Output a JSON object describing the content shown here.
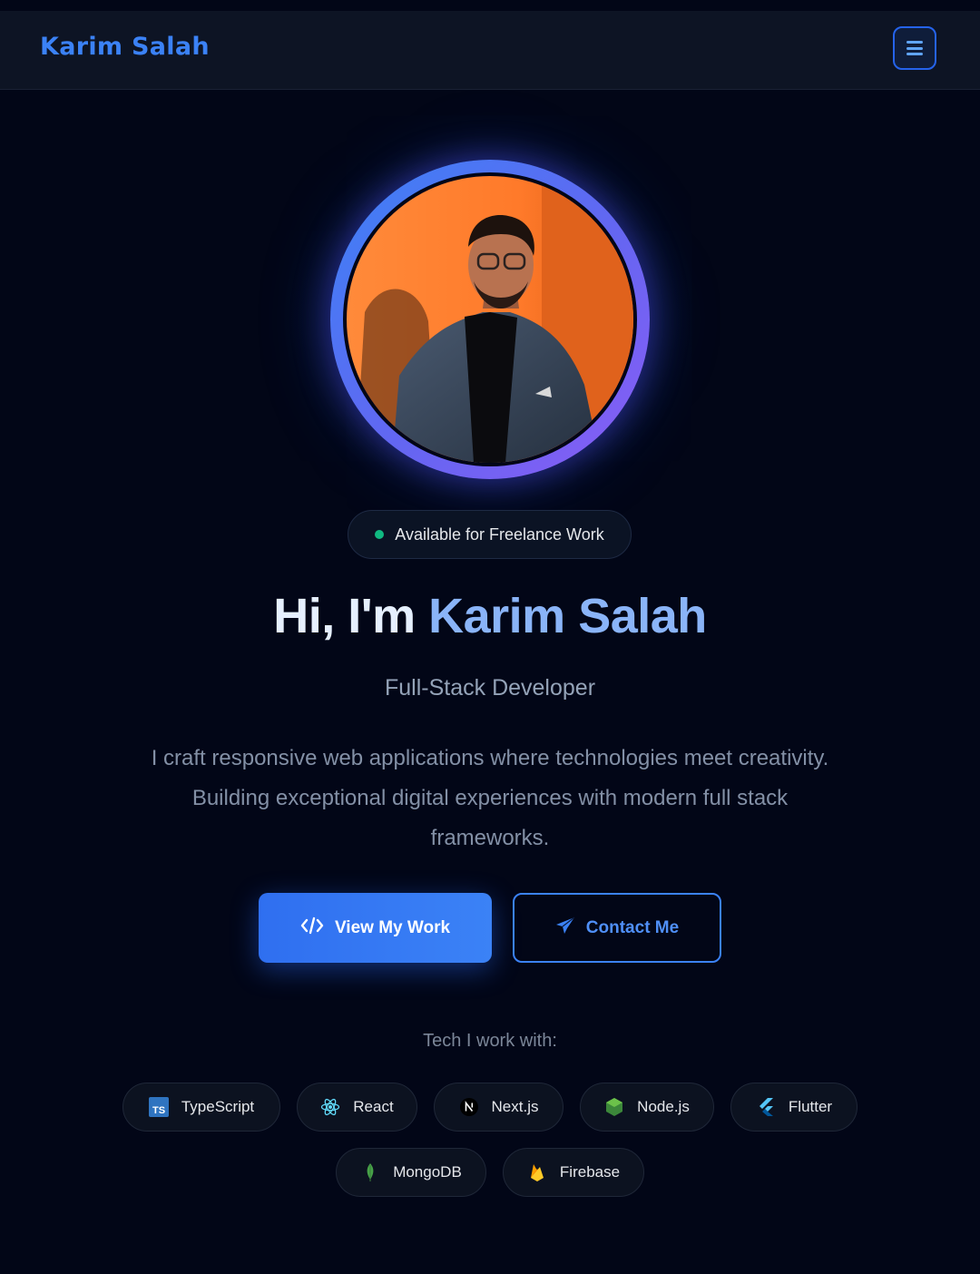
{
  "header": {
    "brand": "Karim Salah",
    "menu_icon": "hamburger-icon"
  },
  "hero": {
    "availability": "Available for Freelance Work",
    "greeting": "Hi, I'm",
    "name": "Karim Salah",
    "role": "Full-Stack Developer",
    "description": "I craft responsive web applications where technologies meet creativity. Building exceptional digital experiences with modern full stack frameworks.",
    "primary_button": {
      "label": "View My Work",
      "icon": "code-icon"
    },
    "secondary_button": {
      "label": "Contact Me",
      "icon": "send-icon"
    }
  },
  "tech": {
    "label": "Tech I work with:",
    "items": [
      {
        "label": "TypeScript",
        "icon": "typescript-icon"
      },
      {
        "label": "React",
        "icon": "react-icon"
      },
      {
        "label": "Next.js",
        "icon": "nextjs-icon"
      },
      {
        "label": "Node.js",
        "icon": "nodejs-icon"
      },
      {
        "label": "Flutter",
        "icon": "flutter-icon"
      },
      {
        "label": "MongoDB",
        "icon": "mongodb-icon"
      },
      {
        "label": "Firebase",
        "icon": "firebase-icon"
      }
    ]
  },
  "colors": {
    "background": "#020617",
    "accent": "#3b82f6",
    "status_dot": "#10b981"
  }
}
